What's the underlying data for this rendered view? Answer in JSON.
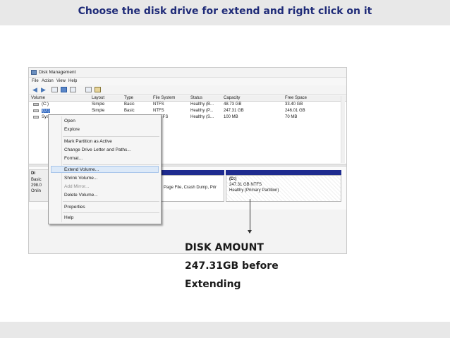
{
  "slide": {
    "title": "Choose the disk drive for extend and right click on it",
    "caption_lines": [
      "DISK AMOUNT",
      "247.31GB before",
      "Extending"
    ]
  },
  "window": {
    "title": "Disk Management",
    "menu": [
      "File",
      "Action",
      "View",
      "Help"
    ],
    "toolbar_icons": [
      "back-arrow-icon",
      "forward-arrow-icon",
      "console-icon",
      "help-icon",
      "properties-icon",
      "refresh-icon",
      "export-icon"
    ]
  },
  "volume_table": {
    "columns": [
      "Volume",
      "Layout",
      "Type",
      "File System",
      "Status",
      "Capacity",
      "Free Space"
    ],
    "rows": [
      [
        "(C:)",
        "Simple",
        "Basic",
        "NTFS",
        "Healthy (B...",
        "48.73 GB",
        "33.40 GB"
      ],
      [
        "(D:)",
        "Simple",
        "Basic",
        "NTFS",
        "Healthy (P...",
        "247.31 GB",
        "246.01 GB"
      ],
      [
        "Sys",
        "",
        "",
        "NTFS",
        "Healthy (S...",
        "100 MB",
        "70 MB"
      ]
    ],
    "partial_cells": {
      "row2_layout": "Simple",
      "row2_type": "Basic",
      "row2_fs": "NTFS",
      "row3_fs": "TFS"
    }
  },
  "disk_map": {
    "disk_label_lines": [
      "Di",
      "Basic",
      "298.0",
      "Onlin"
    ],
    "partition_text": "Page File, Crash Dump, Prir",
    "d_partition": {
      "name": "(D:)",
      "size": "247.31 GB NTFS",
      "status": "Healthy (Primary Partition)"
    }
  },
  "context_menu": {
    "items": [
      {
        "label": "Open",
        "enabled": true
      },
      {
        "label": "Explore",
        "enabled": true
      },
      {
        "label": "Mark Partition as Active",
        "enabled": true
      },
      {
        "label": "Change Drive Letter and Paths...",
        "enabled": true
      },
      {
        "label": "Format...",
        "enabled": true
      },
      {
        "label": "Extend Volume...",
        "enabled": true,
        "highlighted": true
      },
      {
        "label": "Shrink Volume...",
        "enabled": true
      },
      {
        "label": "Add Mirror...",
        "enabled": false
      },
      {
        "label": "Delete Volume...",
        "enabled": true
      },
      {
        "label": "Properties",
        "enabled": true
      },
      {
        "label": "Help",
        "enabled": true
      }
    ]
  },
  "colors": {
    "title_text": "#1f2b78",
    "disk_stripe": "#1e2b8f",
    "selection": "#3a6fc4",
    "menu_highlight": "#dce9f8"
  }
}
